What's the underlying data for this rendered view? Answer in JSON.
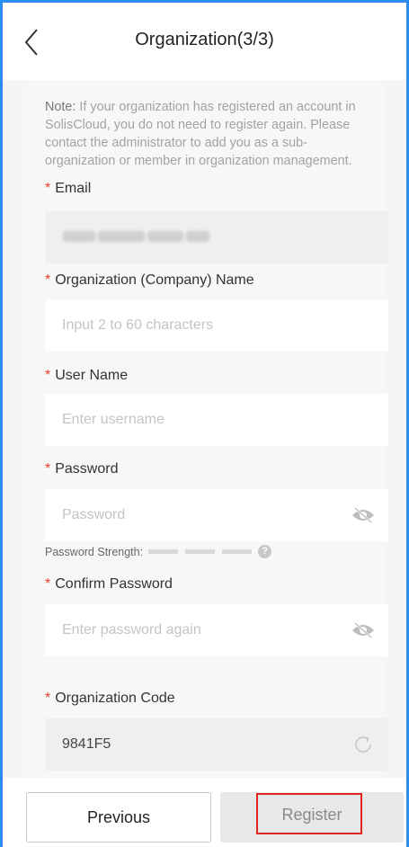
{
  "header": {
    "title": "Organization(3/3)"
  },
  "note": {
    "label": "Note:",
    "text": " If your organization has registered an account in SolisCloud, you do not need to register again. Please contact the administrator to add you as a sub-organization or member in organization management."
  },
  "form": {
    "required_mark": "*",
    "email": {
      "label": "Email"
    },
    "org_name": {
      "label": "Organization (Company) Name",
      "placeholder": "Input 2 to 60 characters"
    },
    "user_name": {
      "label": "User Name",
      "placeholder": "Enter username"
    },
    "password": {
      "label": "Password",
      "placeholder": "Password"
    },
    "strength": {
      "label": "Password Strength:",
      "help": "?"
    },
    "confirm_password": {
      "label": "Confirm Password",
      "placeholder": "Enter password again"
    },
    "org_code": {
      "label": "Organization Code",
      "value": "9841F5"
    }
  },
  "footer": {
    "previous_label": "Previous",
    "register_label": "Register"
  },
  "colors": {
    "required": "#e6422e",
    "frame_border": "#2d8cf0",
    "highlight_box": "#e02424"
  },
  "icons": [
    "chevron-left-icon",
    "eye-off-icon",
    "refresh-icon",
    "question-icon"
  ]
}
